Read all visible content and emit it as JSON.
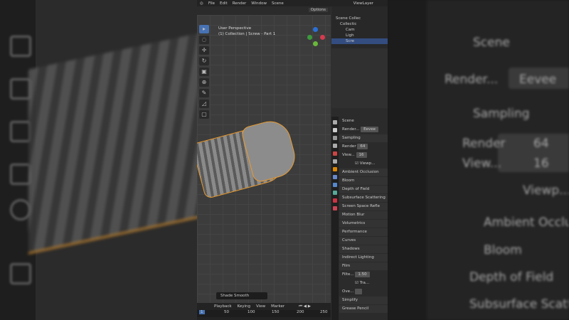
{
  "menu": [
    "File",
    "Edit",
    "Render",
    "Window",
    "Scene"
  ],
  "view_layer": "ViewLayer",
  "options": "Options",
  "viewport": {
    "title": "User Perspective",
    "subtitle": "(1) Collection | Screw - Part 1",
    "operator": "Shade Smooth"
  },
  "outliner": [
    "Scene Collec",
    "Collectic",
    "Cam",
    "Ligh",
    "Scre"
  ],
  "properties": {
    "scene": "Scene",
    "render_label": "Render...",
    "engine": "Eevee",
    "sampling": "Sampling",
    "render": "Render",
    "render_val": "64",
    "viewport_label": "View...",
    "viewport_val": "16",
    "denoise": "Viewp...",
    "panels": [
      "Ambient Occlusion",
      "Bloom",
      "Depth of Field",
      "Subsurface Scattering",
      "Screen Space Refle",
      "Motion Blur",
      "Volumetrics",
      "Performance",
      "Curves",
      "Shadows",
      "Indirect Lighting"
    ],
    "film": "Film",
    "filter": "Filte...",
    "filter_val": "1.50",
    "transparent": "Tra...",
    "overscan": "Ove...",
    "simplify": "Simplify",
    "grease": "Grease Pencil"
  },
  "timeline": {
    "items": [
      "Playback",
      "Keying",
      "View",
      "Marker"
    ],
    "frame": "1",
    "ticks": [
      "50",
      "100",
      "150",
      "200",
      "250"
    ]
  },
  "bg_right": [
    "Scene",
    "Render...",
    "Eevee",
    "Sampling",
    "Render",
    "64",
    "View...",
    "16",
    "Viewp...",
    "Ambient Occlusi",
    "Bloom",
    "Depth of Field",
    "Subsurface Scatterin"
  ]
}
